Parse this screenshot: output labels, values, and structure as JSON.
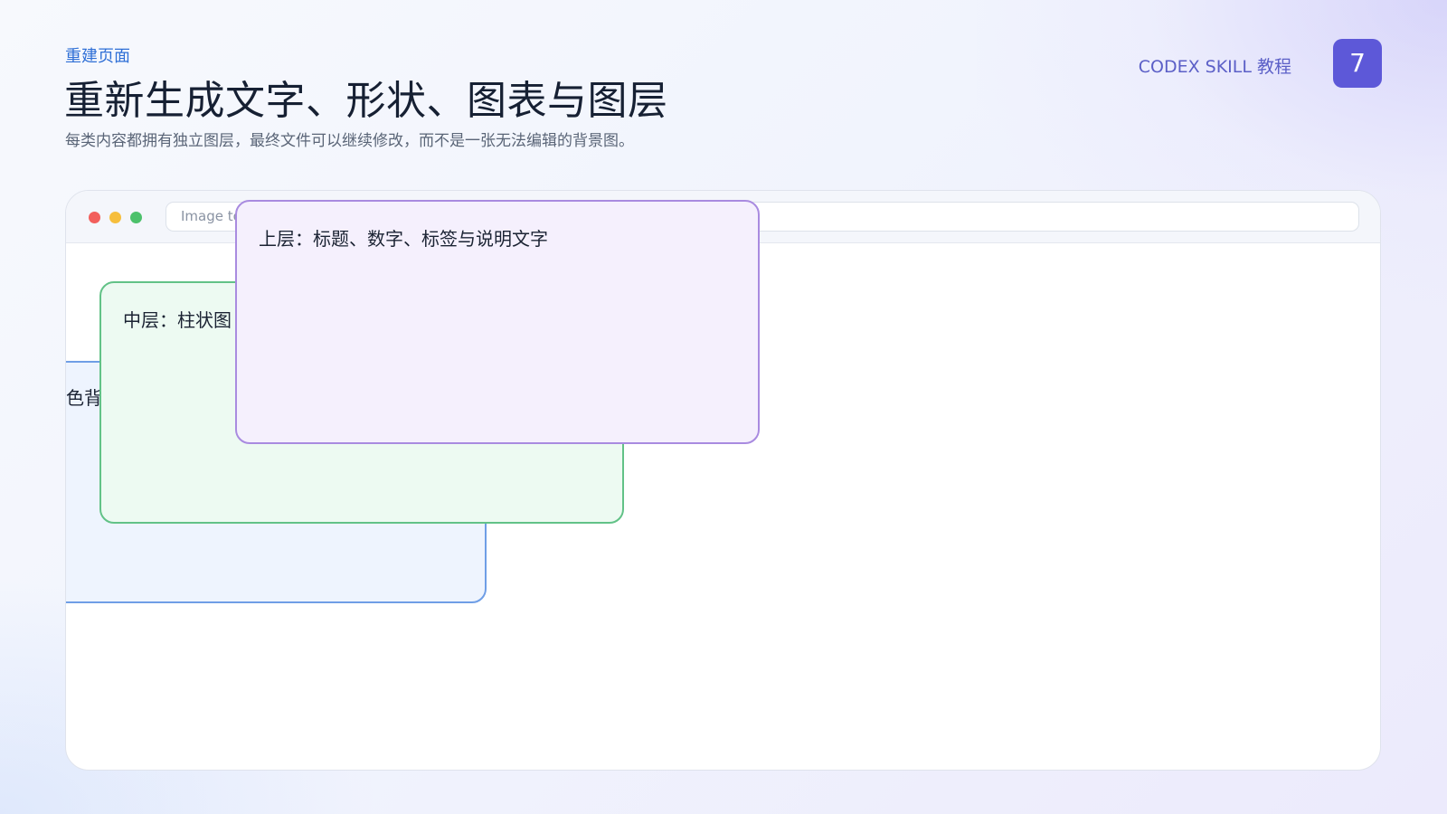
{
  "header": {
    "eyebrow": "重建页面",
    "title": "重新生成文字、形状、图表与图层",
    "subtitle": "每类内容都拥有独立图层，最终文件可以继续修改，而不是一张无法编辑的背景图。"
  },
  "brand": {
    "label": "CODEX SKILL 教程",
    "page_number": "7"
  },
  "window": {
    "address_text": "Image to",
    "layers": {
      "bottom_label": "色背",
      "middle_label": "中层：柱状图",
      "top_label": "上层：标题、数字、标签与说明文字"
    }
  },
  "colors": {
    "accent": "#5d58d8",
    "eyebrow": "#2f6fd6",
    "bottom_layer_border": "#6f9ee6",
    "middle_layer_border": "#62c287",
    "top_layer_border": "#a98be0"
  }
}
